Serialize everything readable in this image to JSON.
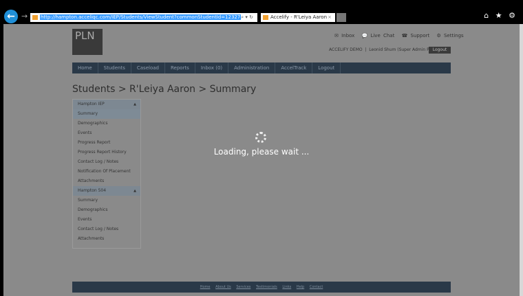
{
  "browser": {
    "url": "http://hampton.acceliqc.com/IEP/Students/ViewStudent?commonStudentId=12327",
    "tab_title": "Accelify - R'Leiya Aaron",
    "tools": "⌕ ▾ ↻",
    "icons": "⌂ ★ ⚙"
  },
  "logo": "PLN",
  "toplinks": [
    {
      "icon": "✉",
      "label": "Inbox"
    },
    {
      "icon": "💬",
      "label": "Live Chat"
    },
    {
      "icon": "☎",
      "label": "Support"
    },
    {
      "icon": "⚙",
      "label": "Settings"
    }
  ],
  "user": {
    "org": "ACCELIFY DEMO",
    "name": "Leonid Shum (Super Admin Plus)",
    "logout": "Logout"
  },
  "nav": [
    "Home",
    "Students",
    "Caseload",
    "Reports",
    "Inbox (0)",
    "Administration",
    "AccelTrack",
    "Logout"
  ],
  "title": "Students > R'Leiya Aaron > Summary",
  "sidebar": {
    "group1": {
      "label": "Hampton IEP",
      "items": [
        "Summary",
        "Demographics",
        "Events",
        "Progress Report",
        "Progress Report History",
        "Contact Log / Notes",
        "Notification Of Placement",
        "Attachments"
      ]
    },
    "group2": {
      "label": "Hampton 504",
      "items": [
        "Summary",
        "Demographics",
        "Events",
        "Contact Log / Notes",
        "Attachments"
      ]
    }
  },
  "loading": "Loading, please wait ...",
  "footer": [
    "Home",
    "About Us",
    "Services",
    "Testimonials",
    "Links",
    "Help",
    "Contact"
  ]
}
